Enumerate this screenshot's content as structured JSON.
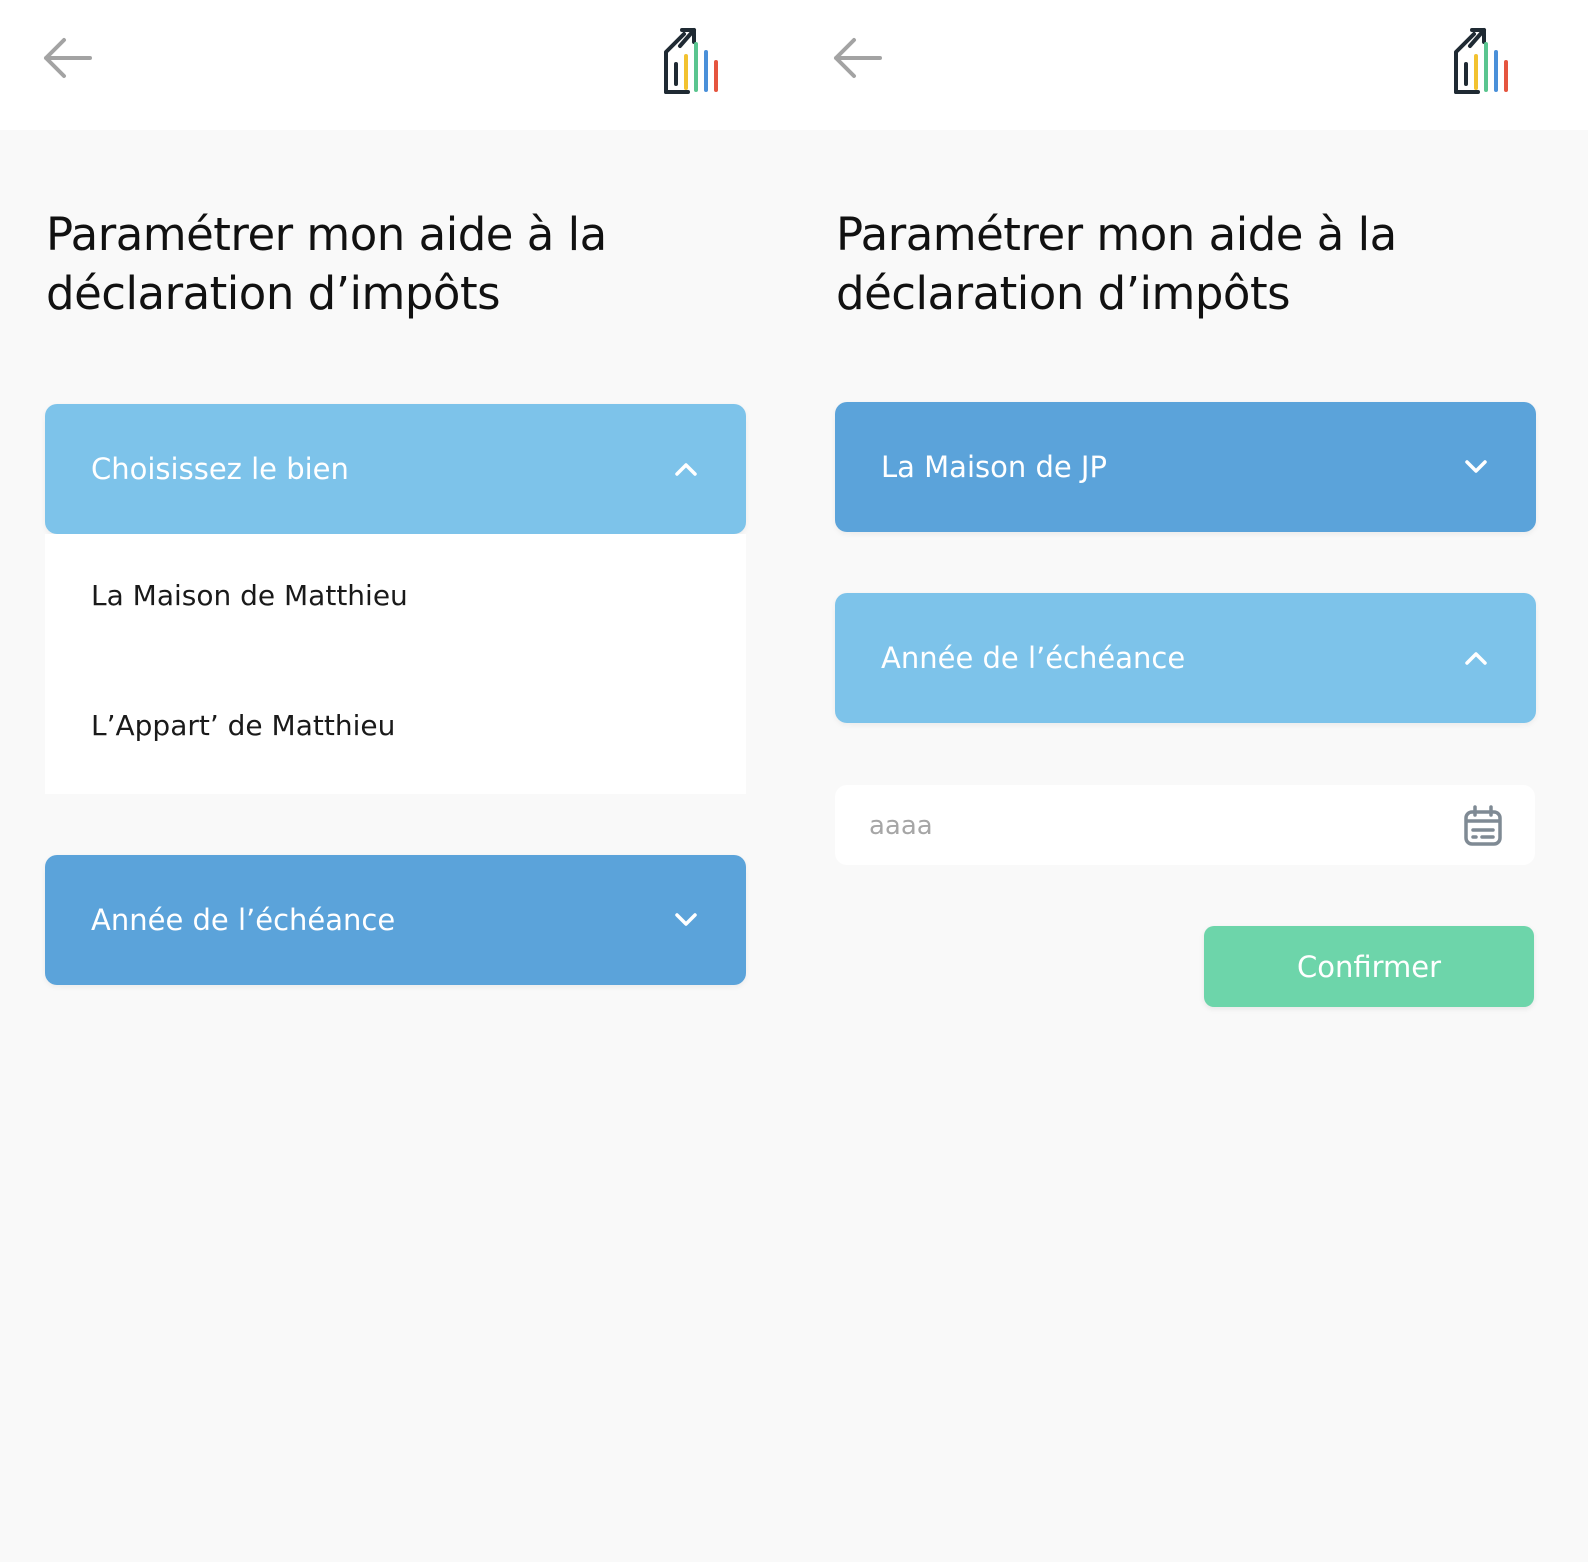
{
  "colors": {
    "background": "#f9f9f9",
    "header": "#ffffff",
    "dropdown_open": "#7dc3ea",
    "dropdown_closed": "#5ba3da",
    "confirm": "#6dd5aa",
    "logo_bars": [
      "#1f2a33",
      "#f2c230",
      "#5ac58f",
      "#4a90d9",
      "#e5553f"
    ]
  },
  "icons": {
    "back": "arrow-left",
    "logo": "house-chart-logo",
    "chevron_open": "chevron-up",
    "chevron_closed": "chevron-down",
    "calendar": "calendar"
  },
  "left_screen": {
    "title": "Paramétrer mon aide à la déclaration d’impôts",
    "property_dropdown": {
      "label": "Choisissez le bien",
      "state": "open",
      "options": [
        "La Maison de Matthieu",
        "L’Appart’ de Matthieu"
      ]
    },
    "year_dropdown": {
      "label": "Année de l’échéance",
      "state": "closed"
    }
  },
  "right_screen": {
    "title": "Paramétrer mon aide à la déclaration d’impôts",
    "property_dropdown": {
      "label": "La Maison de JP",
      "state": "closed"
    },
    "year_dropdown": {
      "label": "Année de l’échéance",
      "state": "open"
    },
    "year_input": {
      "placeholder": "aaaa",
      "value": ""
    },
    "confirm_label": "Confirmer"
  }
}
